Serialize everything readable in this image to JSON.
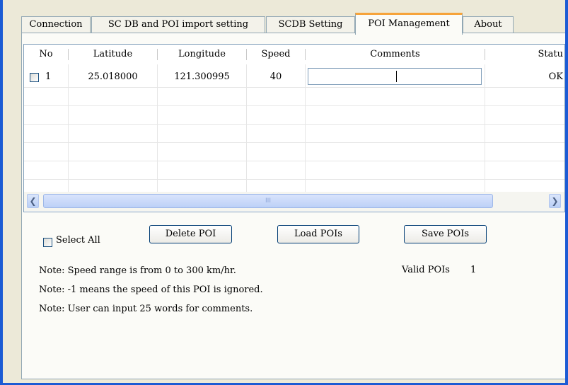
{
  "tabs": [
    "Connection",
    "SC DB and POI import setting",
    "SCDB  Setting",
    "POI Management",
    "About"
  ],
  "active_tab": "POI Management",
  "grid": {
    "columns": [
      "No",
      "Latitude",
      "Longitude",
      "Speed",
      "Comments",
      "Statu"
    ],
    "rows": [
      {
        "checked": false,
        "no": "1",
        "latitude": "25.018000",
        "longitude": "121.300995",
        "speed": "40",
        "comments": "",
        "status": "OK"
      }
    ],
    "scroll_grip": "III"
  },
  "select_all": {
    "label": "Select All",
    "checked": false
  },
  "buttons": {
    "delete": "Delete POI",
    "load": "Load POIs",
    "save": "Save POIs"
  },
  "notes": [
    "Note: Speed range is from 0 to 300 km/hr.",
    "Note: -1 means the speed of this POI is ignored.",
    "Note:  User can input 25 words for comments."
  ],
  "valid_pois": {
    "label": "Valid POIs",
    "value": "1"
  },
  "colors": {
    "accent_tab": "#f6a33a",
    "frame": "#1c5bd4",
    "background": "#ece9d8"
  }
}
